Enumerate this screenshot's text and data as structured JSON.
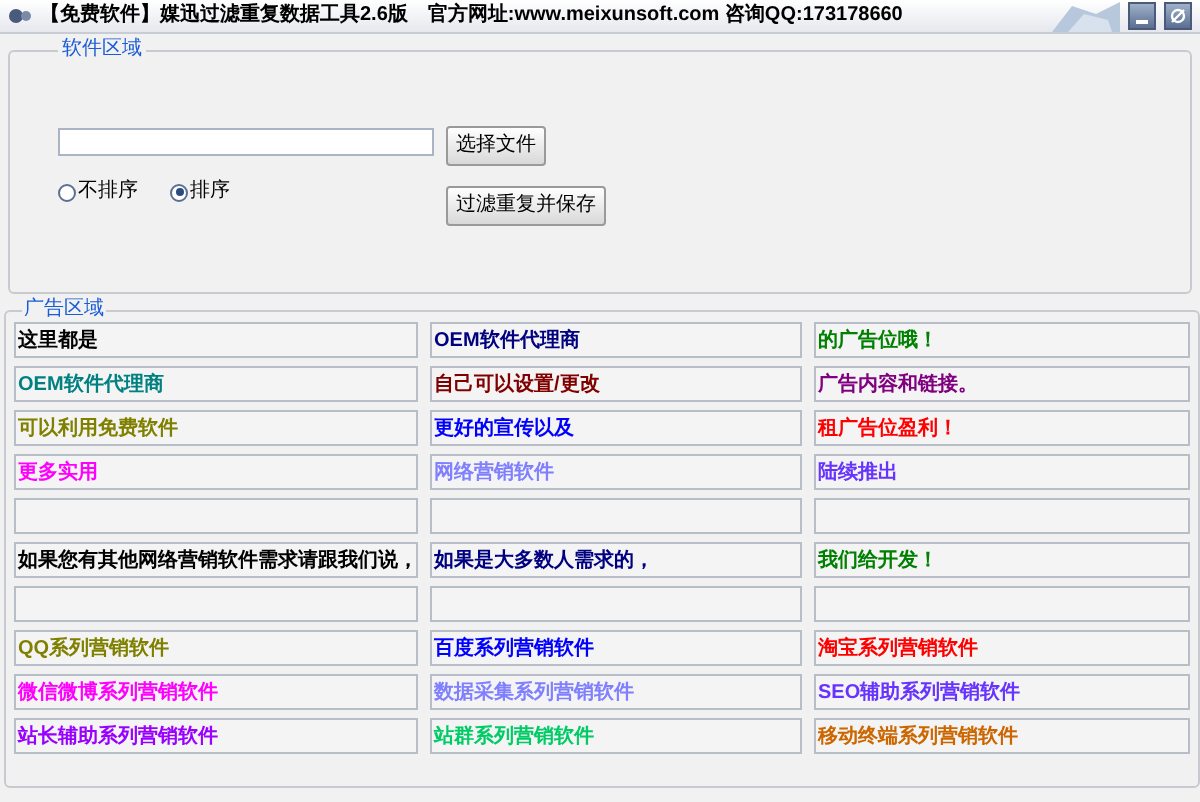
{
  "window": {
    "title": "【免费软件】媒迅过滤重复数据工具2.6版　官方网址:www.meixunsoft.com 咨询QQ:173178660"
  },
  "software_area": {
    "legend": "软件区域",
    "radios": [
      {
        "label": "不排序",
        "selected": false
      },
      {
        "label": "排序",
        "selected": true
      }
    ],
    "buttons": [
      "选择文件",
      "过滤重复并保存"
    ]
  },
  "ad_area": {
    "legend": "广告区域",
    "cells": [
      {
        "kind": "text",
        "text": "这里都是",
        "color": "#000000"
      },
      {
        "kind": "text",
        "text": "OEM软件代理商",
        "color": "#000080"
      },
      {
        "kind": "text",
        "text": "的广告位哦！",
        "color": "#008000"
      },
      {
        "kind": "text",
        "text": "OEM软件代理商",
        "color": "#008080"
      },
      {
        "kind": "text",
        "text": "自己可以设置/更改",
        "color": "#800000"
      },
      {
        "kind": "text",
        "text": "广告内容和链接。",
        "color": "#800080"
      },
      {
        "kind": "text",
        "text": "可以利用免费软件",
        "color": "#808000"
      },
      {
        "kind": "text",
        "text": "更好的宣传以及",
        "color": "#0000ff"
      },
      {
        "kind": "text",
        "text": "租广告位盈利！",
        "color": "#ff0000"
      },
      {
        "kind": "text",
        "text": "更多实用",
        "color": "#ff00ff"
      },
      {
        "kind": "text",
        "text": "网络营销软件",
        "color": "#8080ff"
      },
      {
        "kind": "text",
        "text": "陆续推出",
        "color": "#6633ff"
      },
      {
        "kind": "empty"
      },
      {
        "kind": "empty"
      },
      {
        "kind": "empty"
      },
      {
        "kind": "text",
        "text": "如果您有其他网络营销软件需求请跟我们说，",
        "color": "#000000"
      },
      {
        "kind": "text",
        "text": "如果是大多数人需求的，",
        "color": "#000080"
      },
      {
        "kind": "text",
        "text": "我们给开发！",
        "color": "#008000"
      },
      {
        "kind": "empty"
      },
      {
        "kind": "empty"
      },
      {
        "kind": "empty"
      },
      {
        "kind": "text",
        "text": "QQ系列营销软件",
        "color": "#808000"
      },
      {
        "kind": "text",
        "text": "百度系列营销软件",
        "color": "#0000ff"
      },
      {
        "kind": "text",
        "text": "淘宝系列营销软件",
        "color": "#ff0000"
      },
      {
        "kind": "text",
        "text": "微信微博系列营销软件",
        "color": "#ff00ff"
      },
      {
        "kind": "text",
        "text": "数据采集系列营销软件",
        "color": "#8080ff"
      },
      {
        "kind": "text",
        "text": "SEO辅助系列营销软件",
        "color": "#6633ff"
      },
      {
        "kind": "text",
        "text": "站长辅助系列营销软件",
        "color": "#9900ff"
      },
      {
        "kind": "text",
        "text": "站群系列营销软件",
        "color": "#00cc66"
      },
      {
        "kind": "text",
        "text": "移动终端系列营销软件",
        "color": "#cc6600"
      }
    ]
  }
}
